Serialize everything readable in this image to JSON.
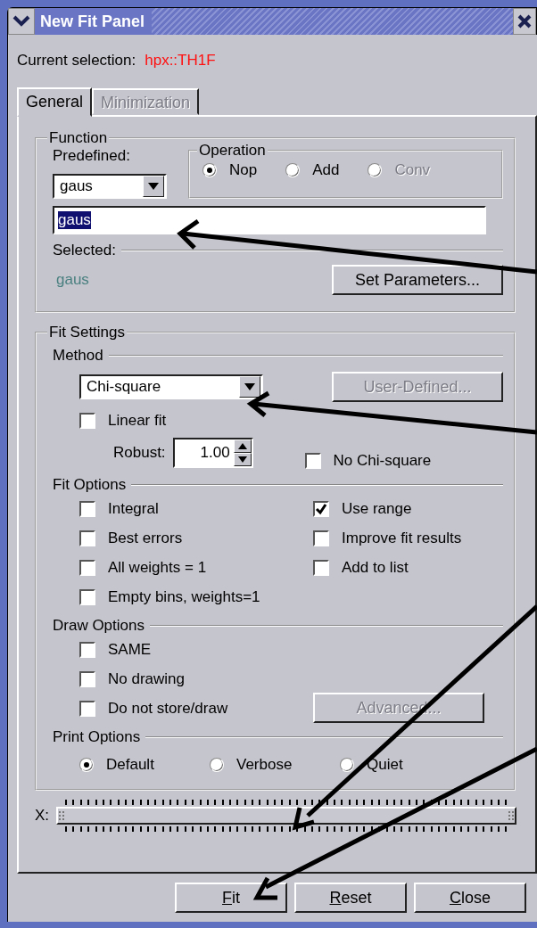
{
  "window": {
    "title": "New Fit Panel"
  },
  "current_selection": {
    "label": "Current selection:",
    "value": "hpx::TH1F"
  },
  "tabs": [
    {
      "label": "General",
      "selected": true,
      "disabled": false
    },
    {
      "label": "Minimization",
      "selected": false,
      "disabled": true
    }
  ],
  "function": {
    "title": "Function",
    "predefined_label": "Predefined:",
    "predefined_value": "gaus",
    "operation": {
      "title": "Operation",
      "options": [
        {
          "label": "Nop",
          "selected": true,
          "disabled": false
        },
        {
          "label": "Add",
          "selected": false,
          "disabled": false
        },
        {
          "label": "Conv",
          "selected": false,
          "disabled": true
        }
      ]
    },
    "formula": "gaus",
    "formula_highlighted": true,
    "selected_label": "Selected:",
    "selected_value": "gaus",
    "set_parameters_button": {
      "label": "Set Parameters...",
      "disabled": false
    }
  },
  "fit_settings": {
    "title": "Fit Settings",
    "method": {
      "title": "Method",
      "value": "Chi-square",
      "user_defined_button": {
        "label": "User-Defined...",
        "disabled": true
      },
      "linear_fit": {
        "label": "Linear fit",
        "checked": false
      },
      "robust_label": "Robust:",
      "robust_value": "1.00",
      "no_chi_square": {
        "label": "No Chi-square",
        "checked": false
      }
    },
    "fit_options": {
      "title": "Fit Options",
      "left": [
        {
          "label": "Integral",
          "checked": false
        },
        {
          "label": "Best errors",
          "checked": false
        },
        {
          "label": "All weights = 1",
          "checked": false
        },
        {
          "label": "Empty bins, weights=1",
          "checked": false
        }
      ],
      "right": [
        {
          "label": "Use range",
          "checked": true
        },
        {
          "label": "Improve fit results",
          "checked": false
        },
        {
          "label": "Add to list",
          "checked": false
        }
      ]
    },
    "draw_options": {
      "title": "Draw Options",
      "options": [
        {
          "label": "SAME",
          "checked": false
        },
        {
          "label": "No drawing",
          "checked": false
        },
        {
          "label": "Do not store/draw",
          "checked": false
        }
      ],
      "advanced_button": {
        "label": "Advanced...",
        "disabled": true
      }
    },
    "print_options": {
      "title": "Print Options",
      "options": [
        {
          "label": "Default",
          "selected": true
        },
        {
          "label": "Verbose",
          "selected": false
        },
        {
          "label": "Quiet",
          "selected": false
        }
      ]
    }
  },
  "range_slider": {
    "label": "X:",
    "level": 1
  },
  "buttons": [
    {
      "label": "Fit"
    },
    {
      "label": "Reset"
    },
    {
      "label": "Close"
    }
  ]
}
